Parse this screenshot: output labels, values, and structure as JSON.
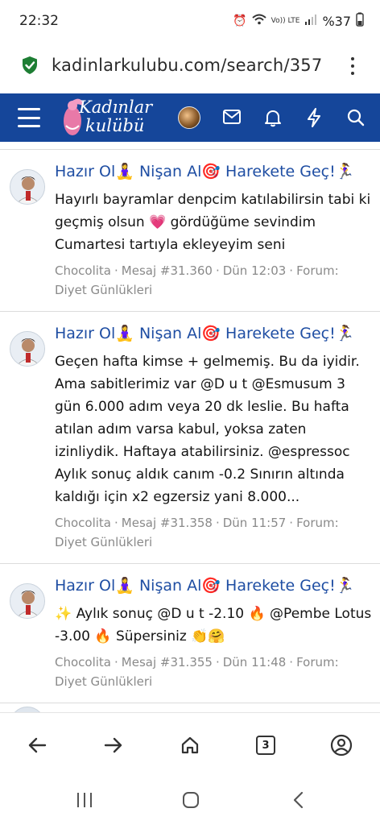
{
  "status_bar": {
    "time": "22:32",
    "network": "Vo)) LTE",
    "battery": "%37"
  },
  "browser": {
    "url": "kadinlarkulubu.com/search/357",
    "menu_icon": "kebab-menu-icon",
    "secure_icon": "shield-check-icon"
  },
  "site_header": {
    "logo_line1": "Kadınlar",
    "logo_line2": "kulübü",
    "icons": [
      "menu-icon",
      "avatar",
      "mail-icon",
      "bell-icon",
      "bolt-icon",
      "search-icon"
    ],
    "bg_color": "#15469a"
  },
  "results": [
    {
      "title": "Hazır Ol🧘‍♀️ Nişan Al🎯 Harekete Geç!🏃‍♀️",
      "snippet": "Hayırlı bayramlar denpcim katılabilirsin tabi ki geçmiş olsun 💗 gördüğüme sevindim Cumartesi tartıyla ekleyeyim seni",
      "author": "Chocolita",
      "post": "Mesaj #31.360",
      "time": "Dün 12:03",
      "forum": "Forum: Diyet Günlükleri"
    },
    {
      "title": "Hazır Ol🧘‍♀️ Nişan Al🎯 Harekete Geç!🏃‍♀️",
      "snippet": "Geçen hafta kimse + gelmemiş. Bu da iyidir. Ama sabitlerimiz var @D u t @Esmusum 3 gün 6.000 adım veya 20 dk leslie. Bu hafta atılan adım varsa kabul, yoksa zaten izinliydik. Haftaya atabilirsiniz. @espressoc Aylık sonuç aldık canım -0.2 Sınırın altında kaldığı için x2 egzersiz yani 8.000...",
      "author": "Chocolita",
      "post": "Mesaj #31.358",
      "time": "Dün 11:57",
      "forum": "Forum: Diyet Günlükleri"
    },
    {
      "title": "Hazır Ol🧘‍♀️ Nişan Al🎯 Harekete Geç!🏃‍♀️",
      "snippet": "✨ Aylık sonuç @D u t -2.10 🔥 @Pembe Lotus -3.00 🔥 Süpersiniz 👏🤗",
      "author": "Chocolita",
      "post": "Mesaj #31.355",
      "time": "Dün 11:48",
      "forum": "Forum: Diyet Günlükleri"
    }
  ],
  "browser_nav": {
    "tab_count": "3",
    "items": [
      "back-icon",
      "forward-icon",
      "home-icon",
      "tabs-icon",
      "account-icon"
    ]
  },
  "system_nav": {
    "items": [
      "recents-icon",
      "home-circle-icon",
      "back-chevron-icon"
    ]
  }
}
